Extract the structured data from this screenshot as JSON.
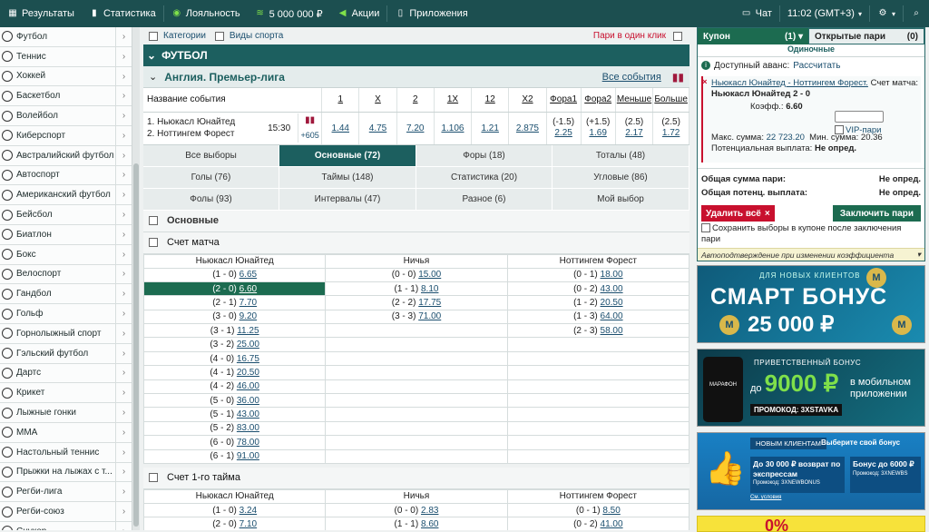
{
  "topbar": {
    "results": "Результаты",
    "stats": "Статистика",
    "loyalty": "Лояльность",
    "bonus": "5 000 000 ₽",
    "promos": "Акции",
    "apps": "Приложения",
    "chat": "Чат",
    "time": "11:02 (GMT+3)"
  },
  "sports": [
    "Футбол",
    "Теннис",
    "Хоккей",
    "Баскетбол",
    "Волейбол",
    "Киберспорт",
    "Австралийский футбол",
    "Автоспорт",
    "Американский футбол",
    "Бейсбол",
    "Биатлон",
    "Бокс",
    "Велоспорт",
    "Гандбол",
    "Гольф",
    "Горнолыжный спорт",
    "Гэльский футбол",
    "Дартс",
    "Крикет",
    "Лыжные гонки",
    "MMA",
    "Настольный теннис",
    "Прыжки на лыжах с т...",
    "Регби-лига",
    "Регби-союз",
    "Снукер"
  ],
  "filters": {
    "categories": "Категории",
    "sport_types": "Виды спорта",
    "parlays": "Пари в один клик"
  },
  "sport_header": "ФУТБОЛ",
  "league": {
    "title": "Англия. Премьер-лига",
    "all_events": "Все события"
  },
  "event_table": {
    "headers": [
      "Название события",
      "1",
      "X",
      "2",
      "1X",
      "12",
      "X2",
      "Фора1",
      "Фора2",
      "Меньше",
      "Больше"
    ],
    "team1": "1. Ньюкасл Юнайтед",
    "team2": "2. Ноттингем Форест",
    "time": "15:30",
    "more": "+605",
    "odds": [
      "1.44",
      "4.75",
      "7.20",
      "1.106",
      "1.21",
      "2.875"
    ],
    "handicap1": {
      "line": "(-1.5)",
      "odd": "2.25"
    },
    "handicap2": {
      "line": "(+1.5)",
      "odd": "1.69"
    },
    "under": {
      "line": "(2.5)",
      "odd": "2.17"
    },
    "over": {
      "line": "(2.5)",
      "odd": "1.72"
    }
  },
  "market_tabs": [
    "Все выборы",
    "Основные (72)",
    "Форы (18)",
    "Тоталы (48)",
    "Голы (76)",
    "Таймы (148)",
    "Статистика (20)",
    "Угловые (86)",
    "Фолы (93)",
    "Интервалы (47)",
    "Разное (6)",
    "Мой выбор"
  ],
  "sections": {
    "main": "Основные",
    "match_score": "Счет матча",
    "first_half": "Счет 1-го тайма"
  },
  "score_cols": [
    "Ньюкасл Юнайтед",
    "Ничья",
    "Ноттингем Форест"
  ],
  "match_score_rows": [
    [
      [
        "(1 - 0)",
        "6.65"
      ],
      [
        "(0 - 0)",
        "15.00"
      ],
      [
        "(0 - 1)",
        "18.00"
      ]
    ],
    [
      [
        "(2 - 0)",
        "6.60"
      ],
      [
        "(1 - 1)",
        "8.10"
      ],
      [
        "(0 - 2)",
        "43.00"
      ]
    ],
    [
      [
        "(2 - 1)",
        "7.70"
      ],
      [
        "(2 - 2)",
        "17.75"
      ],
      [
        "(1 - 2)",
        "20.50"
      ]
    ],
    [
      [
        "(3 - 0)",
        "9.20"
      ],
      [
        "(3 - 3)",
        "71.00"
      ],
      [
        "(1 - 3)",
        "64.00"
      ]
    ],
    [
      [
        "(3 - 1)",
        "11.25"
      ],
      [
        "",
        ""
      ],
      [
        "(2 - 3)",
        "58.00"
      ]
    ],
    [
      [
        "(3 - 2)",
        "25.00"
      ],
      [
        "",
        ""
      ],
      [
        "",
        ""
      ]
    ],
    [
      [
        "(4 - 0)",
        "16.75"
      ],
      [
        "",
        ""
      ],
      [
        "",
        ""
      ]
    ],
    [
      [
        "(4 - 1)",
        "20.50"
      ],
      [
        "",
        ""
      ],
      [
        "",
        ""
      ]
    ],
    [
      [
        "(4 - 2)",
        "46.00"
      ],
      [
        "",
        ""
      ],
      [
        "",
        ""
      ]
    ],
    [
      [
        "(5 - 0)",
        "36.00"
      ],
      [
        "",
        ""
      ],
      [
        "",
        ""
      ]
    ],
    [
      [
        "(5 - 1)",
        "43.00"
      ],
      [
        "",
        ""
      ],
      [
        "",
        ""
      ]
    ],
    [
      [
        "(5 - 2)",
        "83.00"
      ],
      [
        "",
        ""
      ],
      [
        "",
        ""
      ]
    ],
    [
      [
        "(6 - 0)",
        "78.00"
      ],
      [
        "",
        ""
      ],
      [
        "",
        ""
      ]
    ],
    [
      [
        "(6 - 1)",
        "91.00"
      ],
      [
        "",
        ""
      ],
      [
        "",
        ""
      ]
    ]
  ],
  "half_score_rows": [
    [
      [
        "(1 - 0)",
        "3.24"
      ],
      [
        "(0 - 0)",
        "2.83"
      ],
      [
        "(0 - 1)",
        "8.50"
      ]
    ],
    [
      [
        "(2 - 0)",
        "7.10"
      ],
      [
        "(1 - 1)",
        "8.60"
      ],
      [
        "(0 - 2)",
        "41.00"
      ]
    ]
  ],
  "coupon": {
    "tab_label": "Купон",
    "tab_count": "(1)",
    "open_bets": "Открытые пари",
    "open_count": "(0)",
    "single": "Одиночные",
    "advance": "Доступный аванс:",
    "calc": "Рассчитать",
    "event": "Ньюкасл Юнайтед - Ноттингем Форест.",
    "market": "Счет матча:",
    "pick": "Ньюкасл Юнайтед 2 - 0",
    "coef_label": "Коэфф.:",
    "coef": "6.60",
    "vip": "VIP-пари",
    "max_label": "Макс. сумма:",
    "max": "22 723.20",
    "min": "Мин. сумма: 20.36",
    "payout_label": "Потенциальная выплата:",
    "payout": "Не опред.",
    "total_label": "Общая сумма пари:",
    "total": "Не опред.",
    "total_payout_label": "Общая потенц. выплата:",
    "total_payout": "Не опред.",
    "remove_all": "Удалить всё",
    "place": "Заключить пари",
    "keep": "Сохранить выборы в купоне после заключения пари",
    "auto": "Автоподтверждение при изменении коэффициента"
  },
  "banners": {
    "b1_small": "ДЛЯ НОВЫХ КЛИЕНТОВ",
    "b1_title": "СМАРТ БОНУС",
    "b1_amount": "25 000 ₽",
    "b2_small": "ПРИВЕТСТВЕННЫЙ БОНУС",
    "b2_upto": "до",
    "b2_amount": "9000 ₽",
    "b2_side": "в мобильном приложении",
    "b2_promo": "ПРОМОКОД: 3XSTAVKA",
    "b2_phone": "МАРАФОН",
    "b3_tag": "НОВЫМ КЛИЕНТАМ",
    "b3_choose": "Выберите свой бонус",
    "b3_p1": "До 30 000 ₽ возврат по экспрессам",
    "b3_p1_code": "Промокод: 3XNEWBONUS",
    "b3_p2": "Бонус до 6000 ₽",
    "b3_p2_code": "Промокод: 3XNEWBS",
    "b3_cond": "См. условия",
    "b4": "0%"
  }
}
